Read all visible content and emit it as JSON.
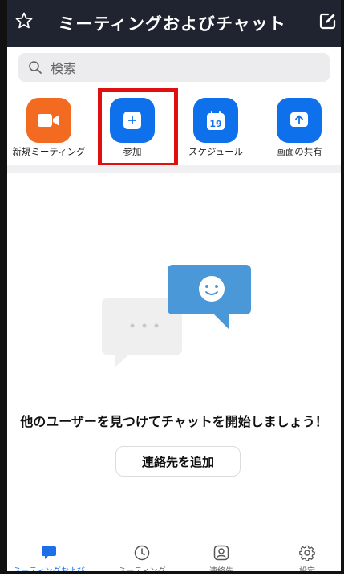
{
  "header": {
    "title": "ミーティングおよびチャット"
  },
  "search": {
    "placeholder": "検索"
  },
  "actions": [
    {
      "label": "新規ミーティング",
      "icon": "video-camera-icon",
      "color": "#f26b21"
    },
    {
      "label": "参加",
      "icon": "plus-icon",
      "color": "#0e71eb"
    },
    {
      "label": "スケジュール",
      "icon": "calendar-icon",
      "color": "#0e71eb",
      "calendar_day": "19"
    },
    {
      "label": "画面の共有",
      "icon": "share-screen-icon",
      "color": "#0e71eb"
    }
  ],
  "empty_state": {
    "message": "他のユーザーを見つけてチャットを開始しましょう！",
    "button_label": "連絡先を追加"
  },
  "bottom_nav": [
    {
      "label": "ミーティングおよび",
      "icon": "chat-bubble-icon",
      "active": true
    },
    {
      "label": "ミーティング",
      "icon": "clock-icon",
      "active": false
    },
    {
      "label": "連絡先",
      "icon": "contact-icon",
      "active": false
    },
    {
      "label": "設定",
      "icon": "gear-icon",
      "active": false
    }
  ],
  "colors": {
    "accent": "#0e71eb",
    "header_bg": "#1f2430",
    "highlight": "#e01010"
  }
}
